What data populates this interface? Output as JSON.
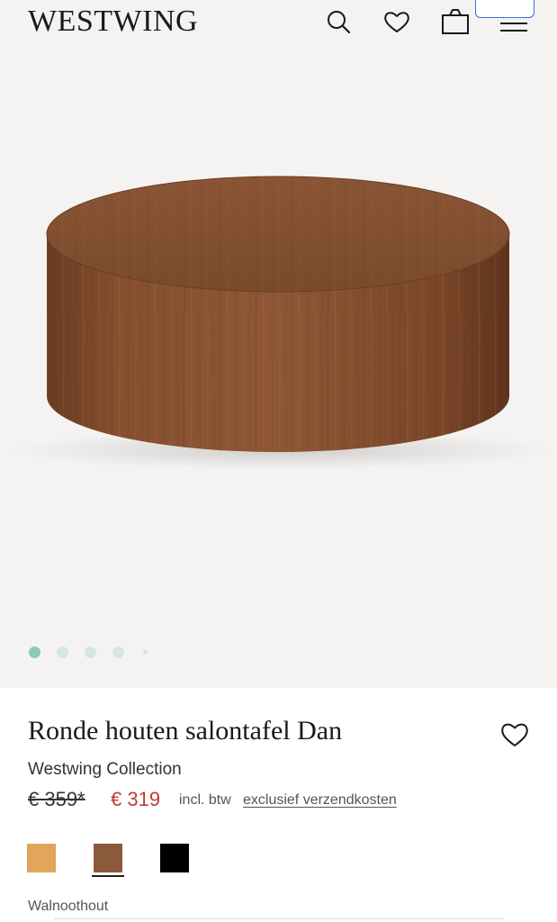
{
  "header": {
    "logo": "WESTWING",
    "icons": [
      "search-icon",
      "heart-icon",
      "bag-icon",
      "menu-icon"
    ]
  },
  "gallery": {
    "dots": [
      "active",
      "inactive",
      "inactive",
      "inactive",
      "small"
    ]
  },
  "product": {
    "title": "Ronde houten salontafel Dan",
    "brand": "Westwing Collection",
    "old_price": "€ 359*",
    "new_price": "€ 319",
    "vat_note": "incl. btw",
    "shipping_link": "exclusief verzendkosten",
    "selected_variant": "Walnoothout",
    "swatches": [
      {
        "name": "light-oak",
        "color": "#e2a55c"
      },
      {
        "name": "walnut",
        "color": "#8b5a3c"
      },
      {
        "name": "black",
        "color": "#000000"
      }
    ]
  },
  "colors": {
    "sale_price": "#c23b2c",
    "dot_active": "#8ec8b8",
    "dot_inactive": "#d5e6e2",
    "background": "#f5f3f1"
  }
}
